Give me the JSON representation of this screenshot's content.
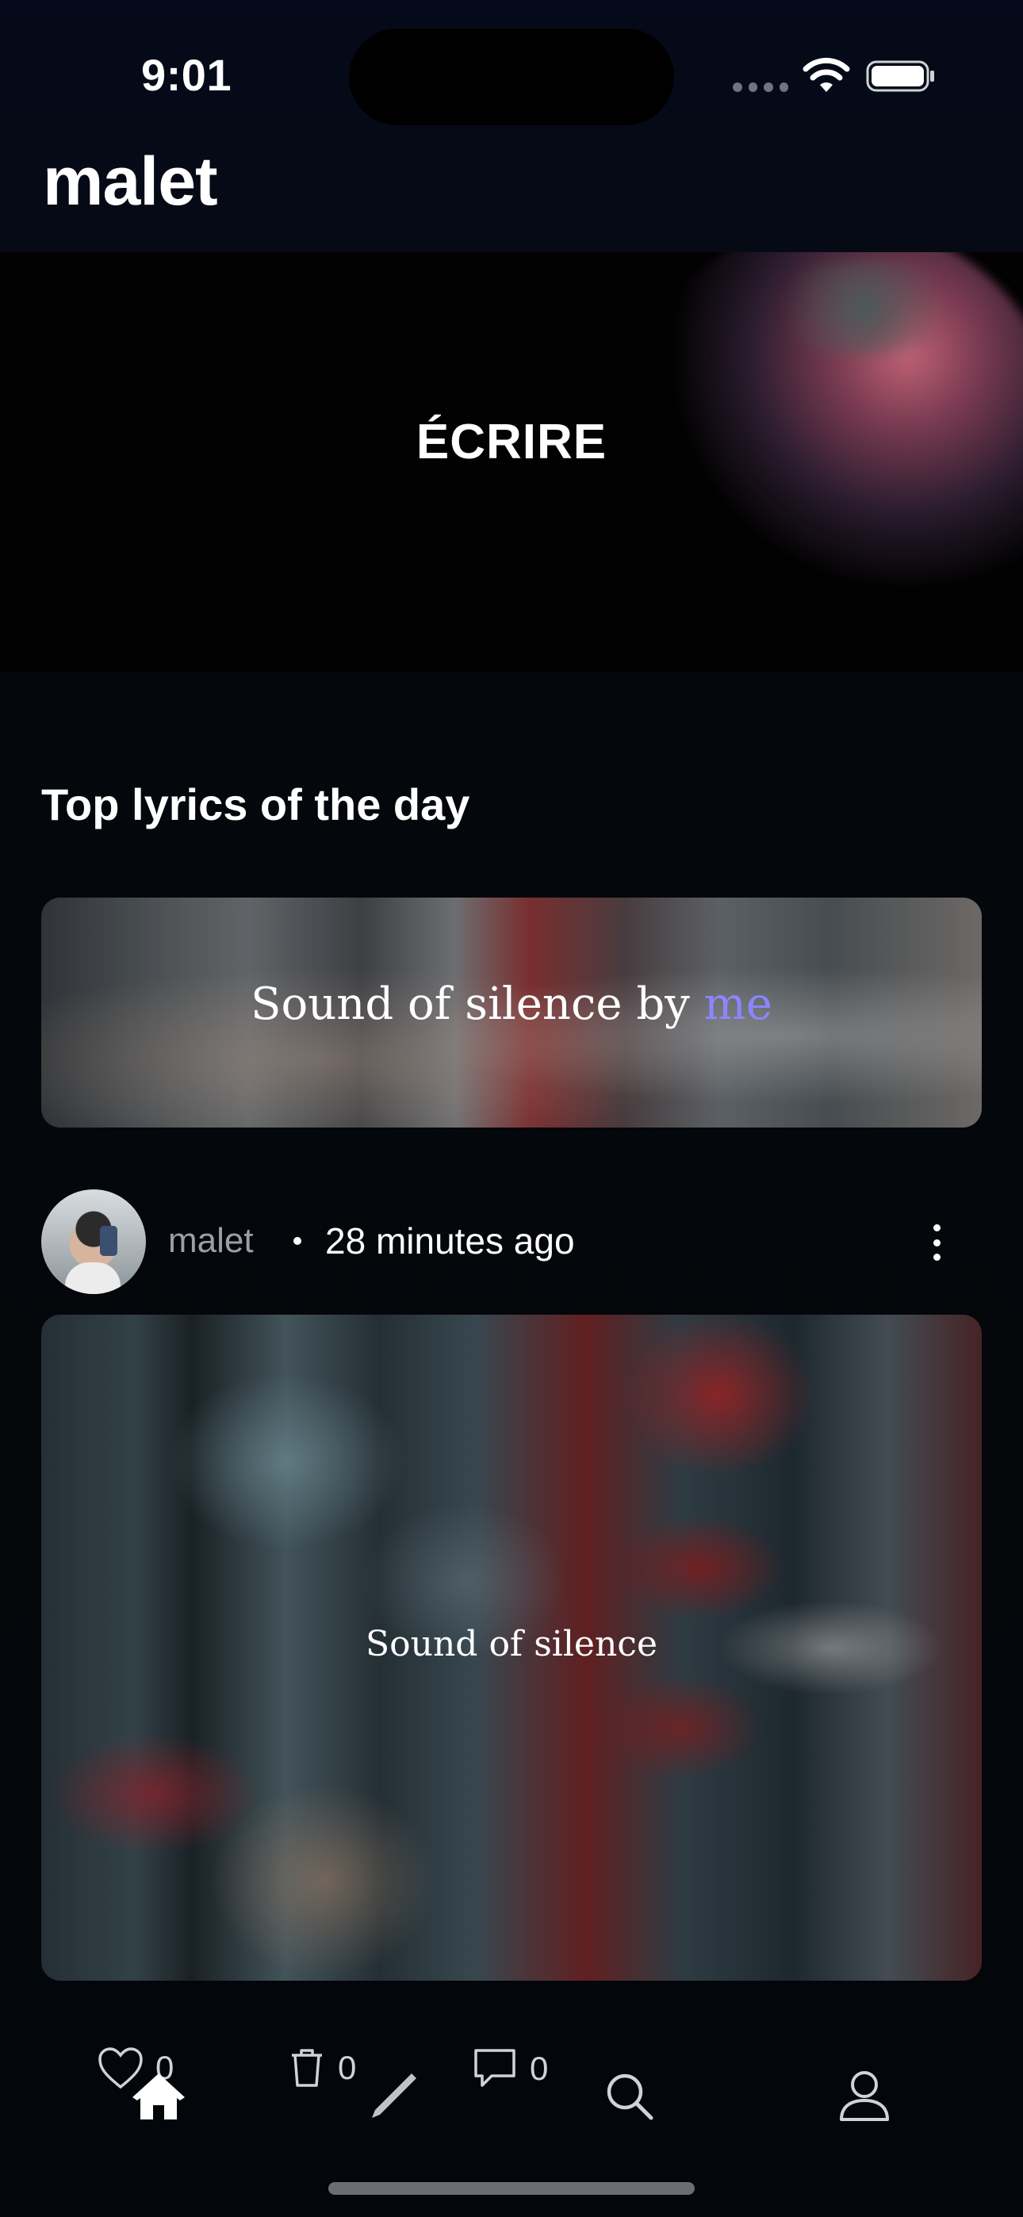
{
  "status_bar": {
    "time": "9:01"
  },
  "header": {
    "app_title": "malet"
  },
  "banner": {
    "label": "ÉCRIRE"
  },
  "top_lyrics": {
    "section_title": "Top lyrics of the day",
    "card": {
      "song": "Sound of silence",
      "by_word": "by",
      "author": "me",
      "author_color": "#8b86ff"
    }
  },
  "post": {
    "username": "malet",
    "separator": "•",
    "time_ago": "28 minutes ago",
    "lyric_title": "Sound of silence",
    "likes": "0",
    "deletes": "0",
    "comments": "0"
  },
  "icons": {
    "like": "heart-icon",
    "delete": "trash-icon",
    "comment": "comment-icon",
    "more": "more-vertical-icon",
    "tabs": [
      "home-icon",
      "pencil-icon",
      "search-icon",
      "profile-icon"
    ]
  },
  "colors": {
    "background": "#04070b",
    "accent": "#8b86ff",
    "text_primary": "#ffffff",
    "text_muted": "#9aa0a6"
  }
}
